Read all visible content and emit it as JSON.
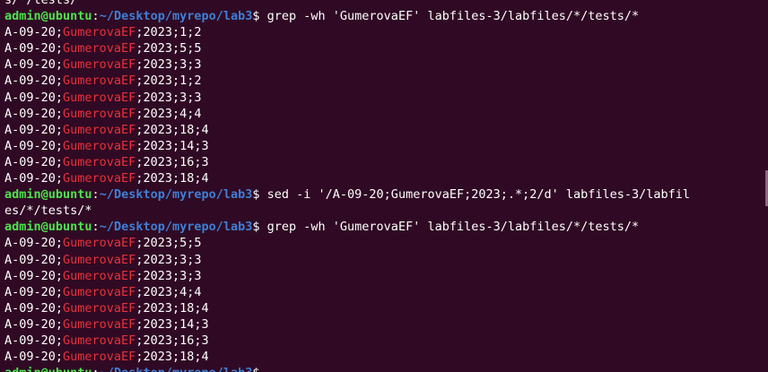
{
  "terminal": {
    "overflow_top": "s/*/tests/",
    "prompt": {
      "user_host": "admin@ubuntu",
      "colon": ":",
      "path": "~/Desktop/myrepo/lab3",
      "symbol": "$ "
    },
    "commands": {
      "grep1": "grep -wh 'GumerovaEF' labfiles-3/labfiles/*/tests/*",
      "sed_part1": "sed -i '/A-09-20;GumerovaEF;2023;.*;2/d' labfiles-3/labfil",
      "sed_part2": "es/*/tests/*",
      "grep2": "grep -wh 'GumerovaEF' labfiles-3/labfiles/*/tests/*"
    },
    "output_prefix": "A-09-20;",
    "match_term": "GumerovaEF",
    "output1": [
      ";2023;1;2",
      ";2023;5;5",
      ";2023;3;3",
      ";2023;1;2",
      ";2023;3;3",
      ";2023;4;4",
      ";2023;18;4",
      ";2023;14;3",
      ";2023;16;3",
      ";2023;18;4"
    ],
    "output2": [
      ";2023;5;5",
      ";2023;3;3",
      ";2023;3;3",
      ";2023;4;4",
      ";2023;18;4",
      ";2023;14;3",
      ";2023;16;3",
      ";2023;18;4"
    ]
  },
  "colors": {
    "background": "#300a24",
    "user_host": "#4ee44e",
    "path": "#3f7fd6",
    "match": "#e8313b",
    "text": "#ffffff"
  }
}
